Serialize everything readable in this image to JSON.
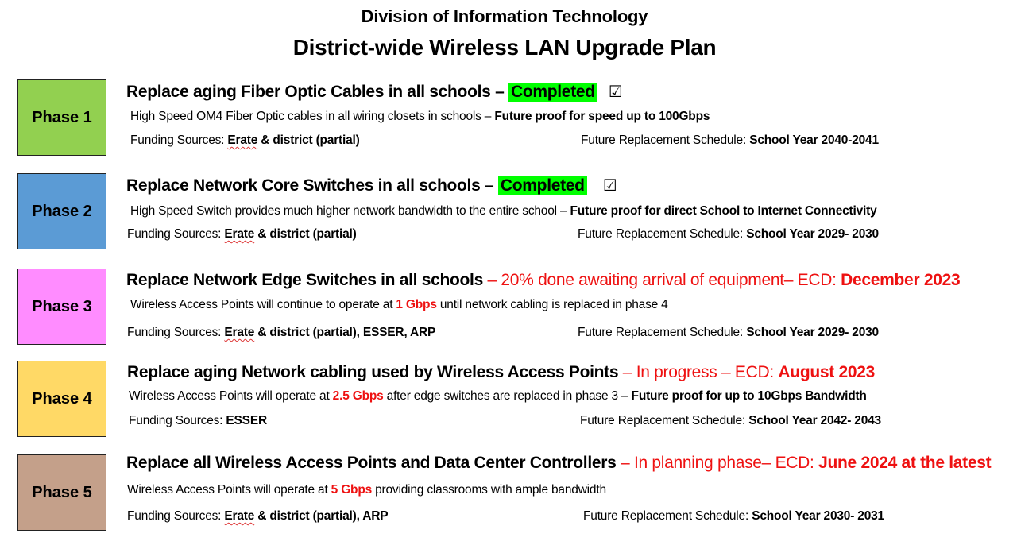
{
  "header": {
    "division": "Division of Information Technology",
    "title": "District-wide Wireless LAN Upgrade Plan"
  },
  "labels": {
    "funding_prefix": "Funding Sources: ",
    "schedule_prefix": "Future Replacement Schedule: ",
    "dash": " – ",
    "ecd_prefix": "ECD: ",
    "check_icon": "☑"
  },
  "colors": {
    "phase1": "#92d050",
    "phase2": "#5b9bd5",
    "phase3": "#ff8cff",
    "phase4": "#ffd966",
    "phase5": "#c4a08a",
    "completed_highlight": "#00ff00",
    "status_red": "#ee1111"
  },
  "phases": [
    {
      "label": "Phase 1",
      "title": "Replace aging Fiber Optic Cables in all schools",
      "status": "Completed",
      "desc_plain": "High Speed OM4 Fiber Optic cables in all wiring closets in schools – ",
      "desc_bold": "Future proof for speed up to 100Gbps",
      "funding_erate": "Erate",
      "funding_rest": " & district (partial)",
      "schedule": "School Year 2040-2041"
    },
    {
      "label": "Phase 2",
      "title": "Replace Network Core Switches in all schools",
      "status": "Completed",
      "desc_plain": "High Speed Switch provides much higher network bandwidth to the entire school – ",
      "desc_bold": "Future proof for direct School to Internet Connectivity",
      "funding_erate": "Erate",
      "funding_rest": " & district (partial)",
      "schedule": "School Year 2029- 2030"
    },
    {
      "label": "Phase 3",
      "title": "Replace Network Edge Switches in all schools",
      "status_text": "20% done awaiting arrival of equipment– ECD: ",
      "status_date": "December 2023",
      "desc_pre": "Wireless Access Points will continue to operate at ",
      "desc_speed": "1 Gbps",
      "desc_post": " until network cabling is replaced in phase 4",
      "funding_erate": "Erate",
      "funding_rest": " & district (partial), ESSER, ARP",
      "schedule": "School Year 2029- 2030"
    },
    {
      "label": "Phase 4",
      "title": "Replace aging Network cabling used by Wireless Access Points",
      "status_text": "In progress – ECD: ",
      "status_date": "August 2023",
      "desc_pre": "Wireless Access Points will operate at ",
      "desc_speed": "2.5 Gbps",
      "desc_post": " after edge switches are replaced in phase 3 – ",
      "desc_bold": "Future proof for up to 10Gbps Bandwidth",
      "funding_all": "ESSER",
      "schedule": "School Year 2042- 2043"
    },
    {
      "label": "Phase 5",
      "title": "Replace all Wireless Access Points and Data Center Controllers",
      "status_text": "In planning phase– ECD: ",
      "status_date": "June 2024 at the latest",
      "desc_pre": "Wireless Access Points will operate at ",
      "desc_speed": "5 Gbps",
      "desc_post": " providing classrooms with ample bandwidth",
      "funding_erate": "Erate",
      "funding_rest": " & district (partial), ARP",
      "schedule": "School Year 2030- 2031"
    }
  ]
}
